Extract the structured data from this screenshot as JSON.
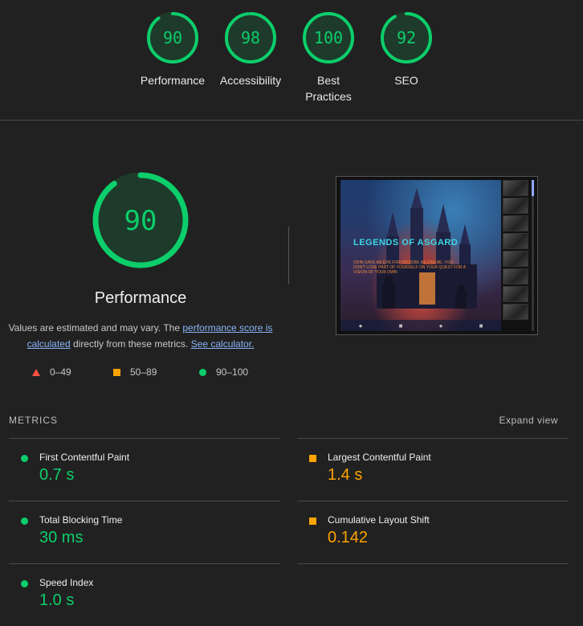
{
  "gauges": [
    {
      "score": 90,
      "label": "Performance"
    },
    {
      "score": 98,
      "label": "Accessibility"
    },
    {
      "score": 100,
      "label": "Best Practices"
    },
    {
      "score": 92,
      "label": "SEO"
    }
  ],
  "performance": {
    "score": 90,
    "title": "Performance",
    "desc_prefix": "Values are estimated and may vary. The ",
    "desc_link": "performance score is calculated",
    "desc_middle": " directly from these metrics. ",
    "desc_link2": "See calculator."
  },
  "legend": {
    "fail": "0–49",
    "average": "50–89",
    "pass": "90–100"
  },
  "screenshot": {
    "title": "LEGENDS OF ASGARD",
    "subtitle": "ODIN GAVE AN EYE FOR WISDOM. AS CAN BE. YOU DON'T LOSE PART OF YOURSELF ON YOUR QUEST FOR A VISION OF YOUR OWN"
  },
  "metrics_header": "METRICS",
  "expand_label": "Expand view",
  "metrics": [
    {
      "name": "First Contentful Paint",
      "value": "0.7 s",
      "status": "pass"
    },
    {
      "name": "Largest Contentful Paint",
      "value": "1.4 s",
      "status": "average"
    },
    {
      "name": "Total Blocking Time",
      "value": "30 ms",
      "status": "pass"
    },
    {
      "name": "Cumulative Layout Shift",
      "value": "0.142",
      "status": "average"
    },
    {
      "name": "Speed Index",
      "value": "1.0 s",
      "status": "pass"
    }
  ],
  "colors": {
    "pass": "#0cce6b",
    "average": "#ffa400",
    "fail": "#ff4e42"
  }
}
